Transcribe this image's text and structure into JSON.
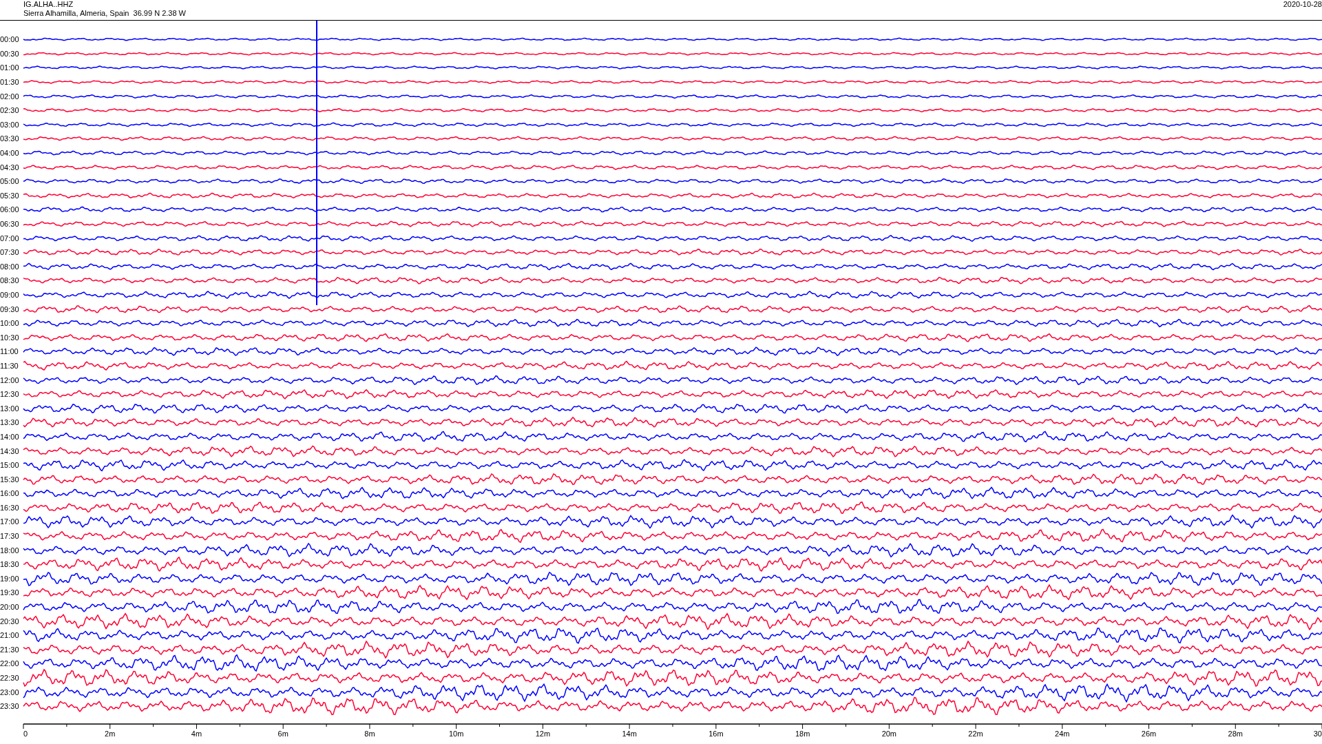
{
  "header": {
    "station": "IG.ALHA..HHZ",
    "location": "Sierra Alhamilla, Almeria, Spain  36.99 N 2.38 W",
    "date": "2020-10-28"
  },
  "rows": [
    {
      "label": "00:00",
      "color": "#0000ff"
    },
    {
      "label": "00:30",
      "color": "#ff0033"
    },
    {
      "label": "01:00",
      "color": "#0000ff"
    },
    {
      "label": "01:30",
      "color": "#ff0033"
    },
    {
      "label": "02:00",
      "color": "#0000ff"
    },
    {
      "label": "02:30",
      "color": "#ff0033"
    },
    {
      "label": "03:00",
      "color": "#0000ff"
    },
    {
      "label": "03:30",
      "color": "#ff0033"
    },
    {
      "label": "04:00",
      "color": "#0000ff"
    },
    {
      "label": "04:30",
      "color": "#ff0033"
    },
    {
      "label": "05:00",
      "color": "#0000ff"
    },
    {
      "label": "05:30",
      "color": "#ff0033"
    },
    {
      "label": "06:00",
      "color": "#0000ff"
    },
    {
      "label": "06:30",
      "color": "#ff0033"
    },
    {
      "label": "07:00",
      "color": "#0000ff"
    },
    {
      "label": "07:30",
      "color": "#ff0033"
    },
    {
      "label": "08:00",
      "color": "#0000ff"
    },
    {
      "label": "08:30",
      "color": "#ff0033"
    },
    {
      "label": "09:00",
      "color": "#0000ff"
    },
    {
      "label": "09:30",
      "color": "#ff0033"
    },
    {
      "label": "10:00",
      "color": "#0000ff"
    },
    {
      "label": "10:30",
      "color": "#ff0033"
    },
    {
      "label": "11:00",
      "color": "#0000ff"
    },
    {
      "label": "11:30",
      "color": "#ff0033"
    },
    {
      "label": "12:00",
      "color": "#0000ff"
    },
    {
      "label": "12:30",
      "color": "#ff0033"
    },
    {
      "label": "13:00",
      "color": "#0000ff"
    },
    {
      "label": "13:30",
      "color": "#ff0033"
    },
    {
      "label": "14:00",
      "color": "#0000ff"
    },
    {
      "label": "14:30",
      "color": "#ff0033"
    },
    {
      "label": "15:00",
      "color": "#0000ff"
    },
    {
      "label": "15:30",
      "color": "#ff0033"
    },
    {
      "label": "16:00",
      "color": "#0000ff"
    },
    {
      "label": "16:30",
      "color": "#ff0033"
    },
    {
      "label": "17:00",
      "color": "#0000ff"
    },
    {
      "label": "17:30",
      "color": "#ff0033"
    },
    {
      "label": "18:00",
      "color": "#0000ff"
    },
    {
      "label": "18:30",
      "color": "#ff0033"
    },
    {
      "label": "19:00",
      "color": "#0000ff"
    },
    {
      "label": "19:30",
      "color": "#ff0033"
    },
    {
      "label": "20:00",
      "color": "#0000ff"
    },
    {
      "label": "20:30",
      "color": "#ff0033"
    },
    {
      "label": "21:00",
      "color": "#0000ff"
    },
    {
      "label": "21:30",
      "color": "#ff0033"
    },
    {
      "label": "22:00",
      "color": "#0000ff"
    },
    {
      "label": "22:30",
      "color": "#ff0033"
    },
    {
      "label": "23:00",
      "color": "#0000ff"
    },
    {
      "label": "23:30",
      "color": "#ff0033"
    }
  ],
  "time_axis": {
    "labels": [
      "0",
      "2m",
      "4m",
      "6m",
      "8m",
      "10m",
      "12m",
      "14m",
      "16m",
      "18m",
      "20m",
      "22m",
      "24m",
      "26m",
      "28m",
      "30"
    ]
  }
}
